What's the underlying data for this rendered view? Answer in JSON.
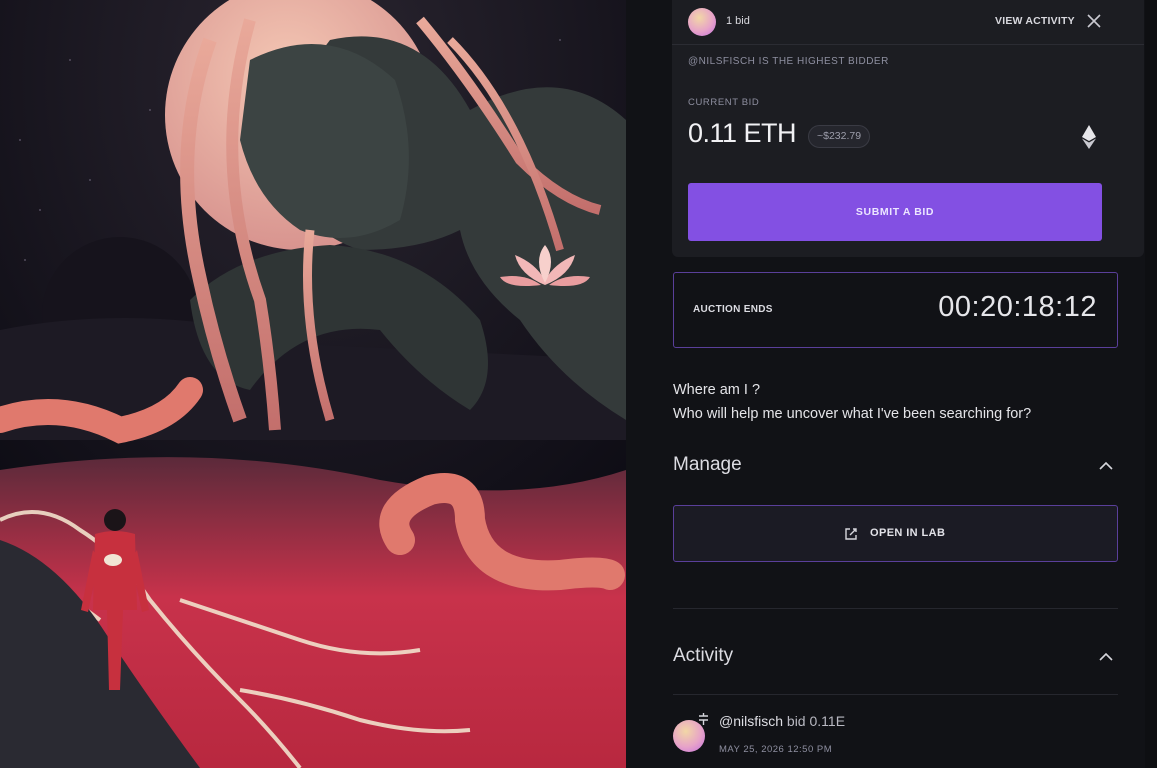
{
  "artwork": {
    "alt": "artwork-image"
  },
  "bid_panel": {
    "bid_count": "1 bid",
    "view_activity_label": "VIEW ACTIVITY",
    "highest_bidder_text": "@NILSFISCH IS THE HIGHEST BIDDER",
    "current_bid_label": "CURRENT BID",
    "current_bid_amount": "0.11 ETH",
    "usd_value": "~$232.79",
    "submit_label": "SUBMIT A BID"
  },
  "auction": {
    "label": "AUCTION ENDS",
    "countdown": "00:20:18:12"
  },
  "description": {
    "line1": "Where am I ?",
    "line2": "Who will help me uncover what I've been searching for?"
  },
  "manage": {
    "title": "Manage",
    "open_lab_label": "OPEN IN LAB"
  },
  "activity": {
    "title": "Activity",
    "items": [
      {
        "user": "@nilsfisch",
        "action": "bid",
        "amount": "0.11E",
        "date": "MAY 25, 2026 12:50 PM"
      }
    ]
  },
  "colors": {
    "accent": "#8350E3",
    "outline": "#5A3F9A",
    "card": "#1C1D22",
    "background": "#111216"
  },
  "icons": {
    "close": "close-x-icon",
    "eth": "ethereum-icon",
    "lab": "external-edit-icon",
    "chevron": "chevron-up-icon",
    "activity_type": "bid-icon"
  }
}
